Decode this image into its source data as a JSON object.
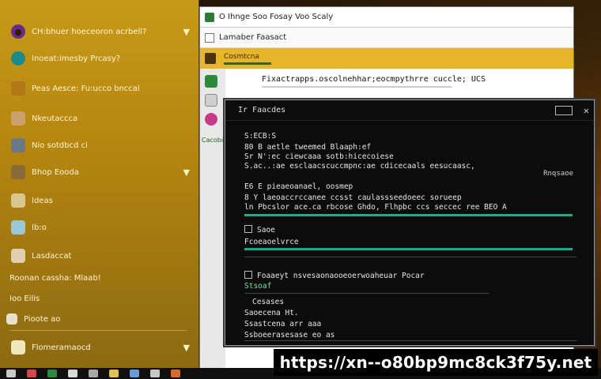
{
  "start_menu": {
    "items": [
      {
        "label": "CH:bhuer hoeceoron acrbell?",
        "icon": "user-icon",
        "color": "#6a2a8a",
        "chevron": "▼"
      },
      {
        "label": "Inoeat:imesby Prcasy?",
        "icon": "edge-browser-icon",
        "color": "#1a8a8a",
        "chevron": ""
      },
      {
        "label": "Peas Aesce: Fu:ucco bnccal",
        "icon": "settings-icon",
        "color": "#b07818",
        "chevron": ""
      },
      {
        "label": "Nkeutaccca",
        "icon": "mail-icon",
        "color": "#c9a070",
        "chevron": ""
      },
      {
        "label": "Nio sotdbcd ci",
        "icon": "document-icon",
        "color": "#6a7a8a",
        "chevron": ""
      },
      {
        "label": "Bhop Eooda",
        "icon": "tools-icon",
        "color": "#8a6a3a",
        "chevron": "▼"
      },
      {
        "label": "Ideas",
        "icon": "folder-icon",
        "color": "#d8c890",
        "chevron": ""
      },
      {
        "label": "Ib:o",
        "icon": "image-icon",
        "color": "#9ac8d8",
        "chevron": ""
      },
      {
        "label": "Lasdaccat",
        "icon": "package-icon",
        "color": "#e0d0b0",
        "chevron": ""
      }
    ],
    "footer_lines": [
      "Roonan cassha: Mlaab!",
      "Ioo Eilis",
      "Pioote ao"
    ],
    "bottom_item": "Flomeramaocd",
    "bottom_chevron": "▼"
  },
  "explorer": {
    "title": "O Ihnge Soo Fosay Voo Scaly",
    "address": "Lamaber Faasact",
    "selected_row": "Cosmtcna",
    "file_line": "Fixactrapps.oscolnehhar;eocmpythrre cuccle; UCS",
    "side_label": "Cacobc"
  },
  "terminal": {
    "title": "Ir Faacdes",
    "lines": [
      "S:ECB:S",
      "80 B aetle tweemed Blaaph:ef",
      "Sr  N':ec ciewcaaa sotb:hicecoiese",
      "S.ac..:ae esclaacscuccmpnc:ae cdicecaals eesucaasc,",
      "E6 E pieaeoanael, oosmep ",
      "8 Y  laeoaccrccanee ccsst caulassseedoeec sorueep",
      "ln Pbcslor ace.ca rbcose Ghdo, Flhpbc ccs seccec ree BEO A"
    ],
    "right_label": "Rnqsaoe",
    "section2_label": "Saoe",
    "section2_title": "Fcoeaoelvrce",
    "section3_title": "Foaaeyt nsvesaonaooeoerwoaheuar Pocar",
    "section3_green": "Stsoaf",
    "section3_lines": [
      "Cesases",
      "Saoecena Ht.  ",
      "Ssastcena arr aaa",
      "Ssboeerasesase eo as"
    ]
  },
  "watermark": "https://xn--o80bp9mc8ck3f75y.net",
  "colors": {
    "start_bg": "#b8880f",
    "selection": "#e6b52c",
    "terminal_bg": "#0c0c0c",
    "progress": "#1fa88a"
  }
}
